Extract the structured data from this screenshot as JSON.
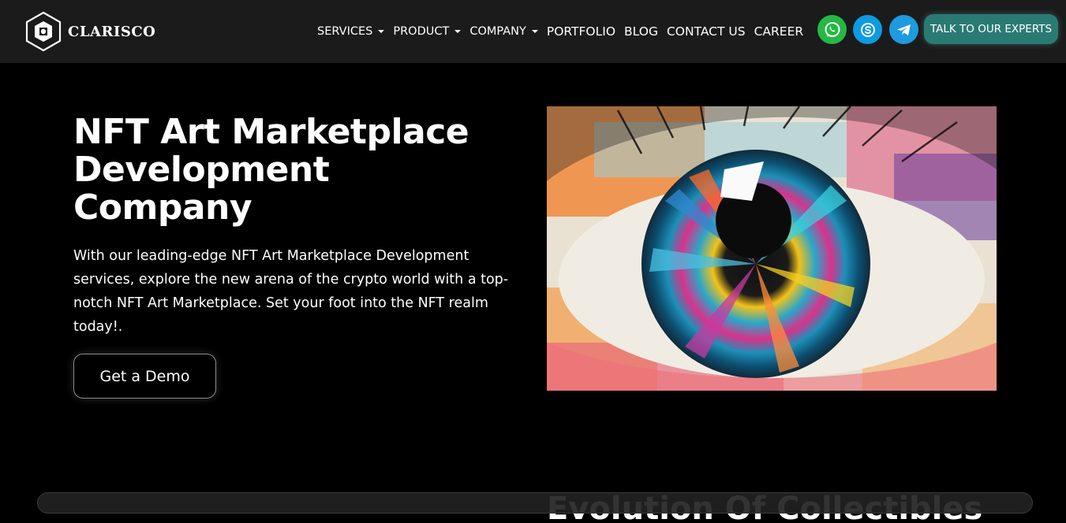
{
  "header": {
    "logo_text": "CLARISCO",
    "nav": [
      {
        "label": "SERVICES",
        "dropdown": true
      },
      {
        "label": "PRODUCT",
        "dropdown": true
      },
      {
        "label": "COMPANY",
        "dropdown": true
      },
      {
        "label": "PORTFOLIO",
        "dropdown": false
      },
      {
        "label": "BLOG",
        "dropdown": false
      },
      {
        "label": "CONTACT US",
        "dropdown": false
      },
      {
        "label": "CAREER",
        "dropdown": false
      }
    ],
    "social": [
      {
        "name": "whatsapp-icon",
        "color": "#25b845"
      },
      {
        "name": "skype-icon",
        "color": "#0d9ae0"
      },
      {
        "name": "telegram-icon",
        "color": "#1d9ae0"
      }
    ],
    "cta_label": "TALK TO OUR EXPERTS"
  },
  "hero": {
    "title": "NFT Art Marketplace Development Company",
    "description": "With our leading-edge NFT Art Marketplace Development services, explore the new arena of the crypto world with a top-notch NFT Art Marketplace. Set your foot into the NFT realm today!.",
    "demo_button": "Get a Demo",
    "image_subject": "colorful painted eye artwork"
  },
  "next_section": {
    "title": "Evolution Of Collectibles"
  },
  "colors": {
    "header_bg": "#1b1b1b",
    "page_bg": "#000000",
    "cta_bg": "#2a7a74"
  }
}
